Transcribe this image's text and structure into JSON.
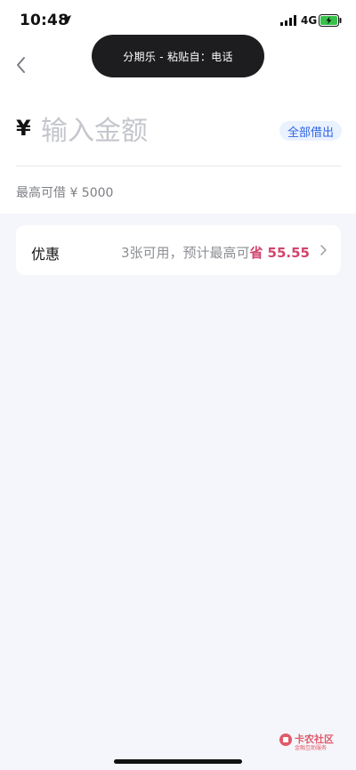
{
  "status_bar": {
    "time": "10:48",
    "network": "4G"
  },
  "toast": {
    "text": "分期乐 - 粘贴自：电话"
  },
  "amount": {
    "currency": "¥",
    "placeholder": "输入金额",
    "borrow_all_label": "全部借出",
    "max_label": "最高可借 ¥ 5000"
  },
  "discount": {
    "label": "优惠",
    "summary": "3张可用，预计最高可",
    "save_label": "省",
    "save_value": "55.55"
  },
  "watermark": {
    "text": "卡农社区",
    "subtext": "金融互助服务"
  },
  "colors": {
    "accent_blue": "#2f66e4",
    "accent_pink": "#d2456e",
    "background": "#f5f6fb"
  }
}
